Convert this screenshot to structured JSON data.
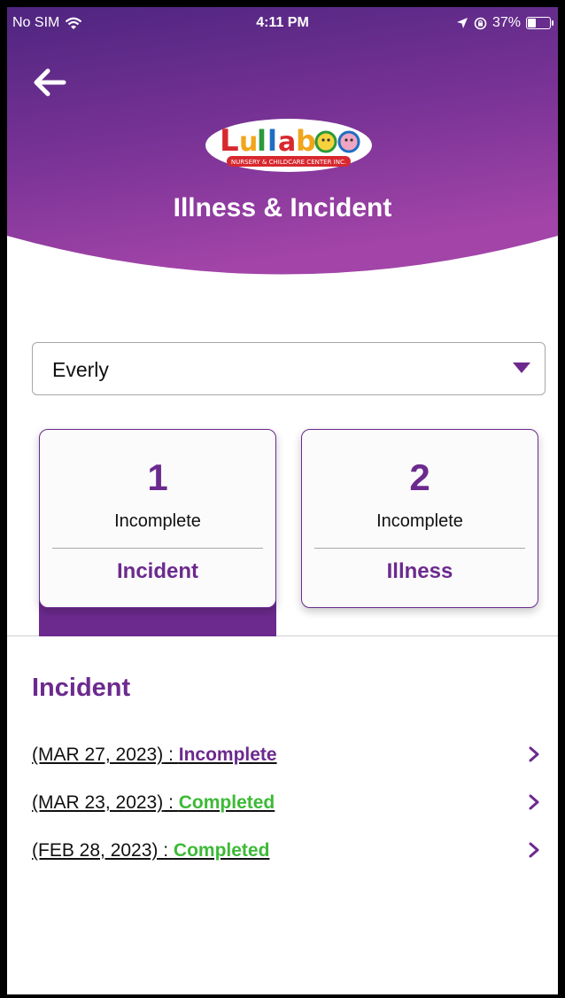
{
  "status_bar": {
    "carrier": "No SIM",
    "time": "4:11 PM",
    "battery": "37%"
  },
  "header": {
    "title": "Illness & Incident",
    "logo": {
      "brand": "Lullaboo",
      "tagline": "NURSERY & CHILDCARE CENTER INC."
    }
  },
  "child_select": {
    "value": "Everly"
  },
  "cards": [
    {
      "count": "1",
      "status": "Incomplete",
      "category": "Incident",
      "selected": true
    },
    {
      "count": "2",
      "status": "Incomplete",
      "category": "Illness",
      "selected": false
    }
  ],
  "section": {
    "title": "Incident",
    "items": [
      {
        "date": "(MAR 27, 2023)",
        "sep": " : ",
        "status": "Incomplete"
      },
      {
        "date": "(MAR 23, 2023)",
        "sep": " : ",
        "status": "Completed"
      },
      {
        "date": "(FEB 28, 2023)",
        "sep": " : ",
        "status": "Completed"
      }
    ]
  },
  "colors": {
    "accent": "#6c2a8e",
    "header_top": "#5a2a86",
    "header_bottom": "#9a3ea4",
    "completed": "#3dba36"
  },
  "icons": {
    "back": "arrow-left-icon",
    "dropdown": "triangle-down-icon",
    "row": "chevron-right-icon",
    "wifi": "wifi-icon",
    "location": "location-arrow-icon",
    "rotation_lock": "rotation-lock-icon",
    "battery": "battery-icon"
  }
}
